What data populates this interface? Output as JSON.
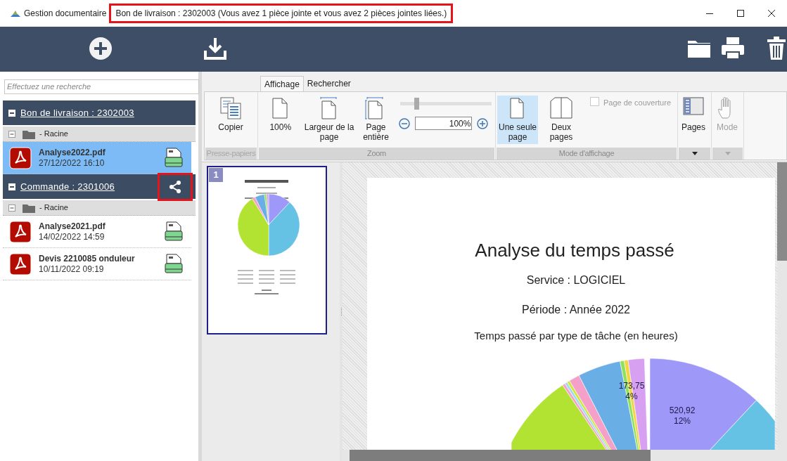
{
  "window": {
    "app_title": "Gestion documentaire",
    "document_title": "Bon de livraison : 2302003 (Vous avez 1 pièce jointe et vous avez 2 pièces jointes liées.)",
    "document_title_highlighted": true
  },
  "search": {
    "placeholder": "Effectuez une recherche"
  },
  "groups": [
    {
      "title": "Bon de livraison : 2302003",
      "expanded": true,
      "shared": false,
      "folders": [
        {
          "label": "- Racine",
          "expanded": true,
          "files": [
            {
              "name": "Analyse2022.pdf",
              "date": "27/12/2022 16:10",
              "selected": true
            }
          ]
        }
      ]
    },
    {
      "title": "Commande : 2301006",
      "expanded": true,
      "shared": true,
      "share_highlighted": true,
      "folders": [
        {
          "label": "- Racine",
          "expanded": true,
          "files": [
            {
              "name": "Analyse2021.pdf",
              "date": "14/02/2022 14:59",
              "selected": false
            },
            {
              "name": "Devis 2210085 onduleur",
              "date": "10/11/2022 09:19",
              "selected": false
            }
          ]
        }
      ]
    }
  ],
  "ribbon": {
    "tabs": [
      {
        "label": "Affichage",
        "selected": true
      },
      {
        "label": "Rechercher",
        "selected": false
      }
    ],
    "groups": [
      {
        "label": "Presse-papiers",
        "disabled": true,
        "items": [
          {
            "kind": "copy",
            "label": "Copier"
          }
        ]
      },
      {
        "label": "Zoom",
        "disabled": false,
        "items": [
          {
            "kind": "page",
            "label": "100%"
          },
          {
            "kind": "fitwidth",
            "label": "Largeur de la page"
          },
          {
            "kind": "fitpage",
            "label": "Page entière"
          },
          {
            "kind": "zoom",
            "level": 0.17,
            "value": "100%"
          }
        ]
      },
      {
        "label": "Mode d'affichage",
        "disabled": false,
        "items": [
          {
            "kind": "single",
            "label": "Une seule page",
            "selected": true
          },
          {
            "kind": "double",
            "label": "Deux pages",
            "selected": false
          },
          {
            "kind": "checkbox",
            "label": "Page de couverture",
            "checked": false,
            "disabled": true
          }
        ]
      },
      {
        "disabled": false,
        "items": [
          {
            "kind": "pages",
            "label": "Pages",
            "disabled": false
          }
        ]
      },
      {
        "disabled": true,
        "items": [
          {
            "kind": "hand",
            "label": "Mode",
            "disabled": true
          }
        ]
      }
    ]
  },
  "thumbnails": [
    {
      "number": "1",
      "selected": true
    }
  ],
  "document": {
    "title": "Analyse du temps passé",
    "service": "Service : LOGICIEL",
    "period": "Période : Année 2022",
    "chart_title": "Temps passé par type de tâche (en heures)",
    "slice_labels": [
      {
        "value": "173,75",
        "percent": "4%"
      },
      {
        "value": "520,92",
        "percent": "12%"
      }
    ]
  }
}
